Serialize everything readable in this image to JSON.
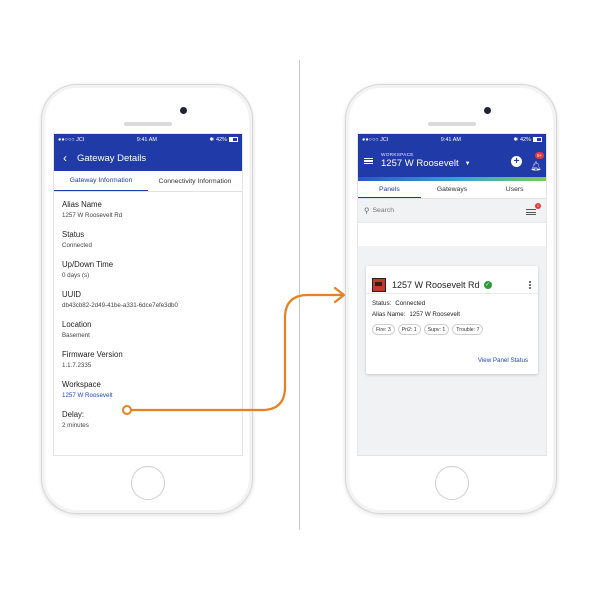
{
  "colors": {
    "brand_blue": "#203ba8",
    "link_blue": "#1c49c2",
    "connector_orange": "#e8811f",
    "status_ok": "#2d9a3c",
    "badge_red": "#e23a3a"
  },
  "left_screen": {
    "status_bar": {
      "carrier": "●●○○○ JCI",
      "wifi_icon": "wifi-icon",
      "time": "9:41 AM",
      "bluetooth_icon": "bluetooth-icon",
      "battery": "42%"
    },
    "header": {
      "back_icon": "chevron-left-icon",
      "title": "Gateway Details"
    },
    "tabs": [
      {
        "label": "Gateway Information",
        "active": true
      },
      {
        "label": "Connectivity Information",
        "active": false
      }
    ],
    "fields": [
      {
        "label": "Alias Name",
        "value": "1257 W Roosevelt Rd"
      },
      {
        "label": "Status",
        "value": "Connected"
      },
      {
        "label": "Up/Down Time",
        "value": "0 days (s)"
      },
      {
        "label": "UUID",
        "value": "db43cb82-2d49-41be-a331-6dce7efe3db0"
      },
      {
        "label": "Location",
        "value": "Basement"
      },
      {
        "label": "Firmware Version",
        "value": "1.1.7.2335"
      },
      {
        "label": "Workspace",
        "value": "1257 W Roosevelt"
      },
      {
        "label": "Delay:",
        "value": "2 minutes"
      }
    ]
  },
  "right_screen": {
    "status_bar": {
      "carrier": "●●○○○ JCI",
      "wifi_icon": "wifi-icon",
      "time": "9:41 AM",
      "bluetooth_icon": "bluetooth-icon",
      "battery": "42%"
    },
    "header": {
      "caption": "WORKSPACE",
      "workspace_name": "1257 W Roosevelt",
      "notification_badge": "9+"
    },
    "tabs": [
      {
        "label": "Panels",
        "active": true
      },
      {
        "label": "Gateways",
        "active": false
      },
      {
        "label": "Users",
        "active": false
      }
    ],
    "search": {
      "placeholder": "Search",
      "filter_badge": "1"
    },
    "panel_card": {
      "title": "1257 W Roosevelt Rd",
      "status_label": "Status:",
      "status_value": "Connected",
      "alias_label": "Alias Name:",
      "alias_value": "1257 W Roosevelt",
      "chips": [
        "Fire: 3",
        "Pri2: 1",
        "Supv: 1",
        "Trouble: 7"
      ],
      "link_label": "View Panel Status"
    }
  }
}
